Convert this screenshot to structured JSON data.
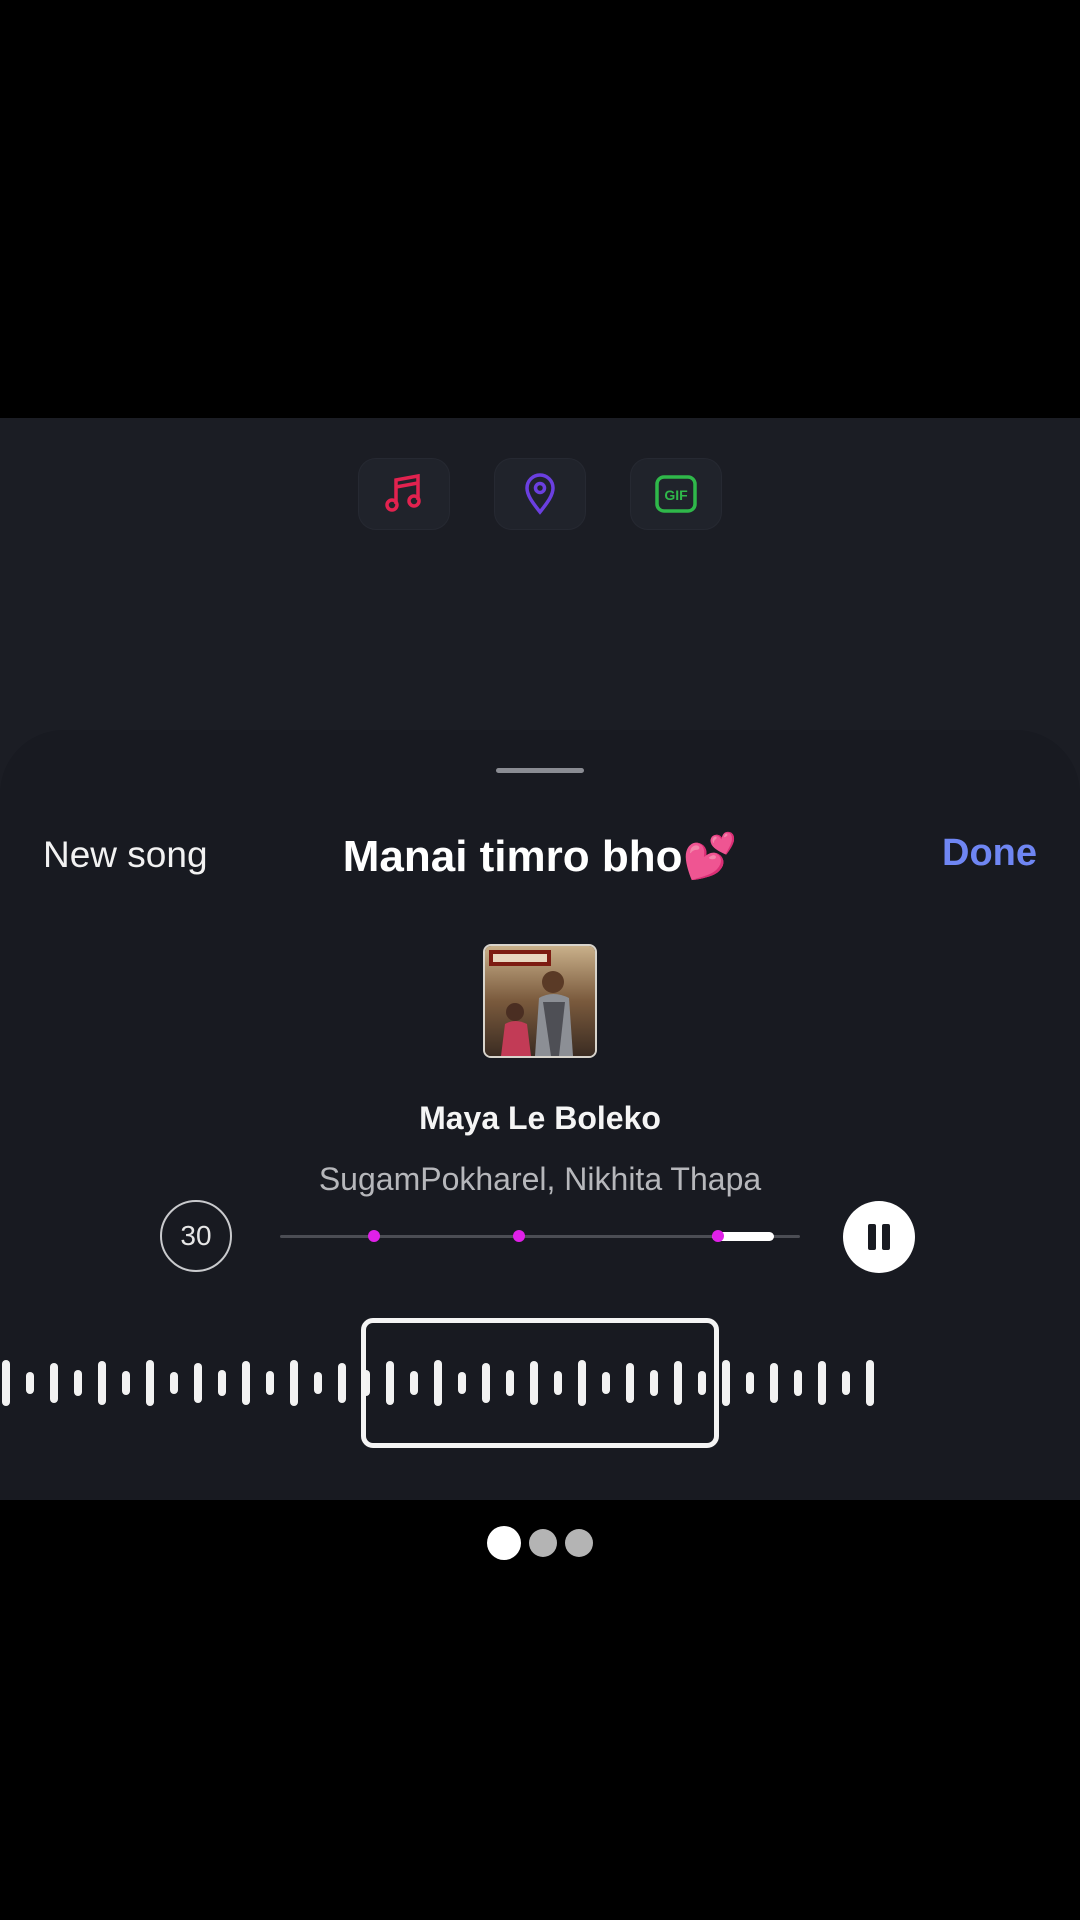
{
  "stickers": [
    {
      "icon": "music-note-icon",
      "color": "#e2224f"
    },
    {
      "icon": "location-pin-icon",
      "color": "#6b3fe0"
    },
    {
      "icon": "gif-icon",
      "label": "GIF",
      "color": "#2fb84a"
    }
  ],
  "header": {
    "new_song_label": "New song",
    "title": "Manai timro bho💕",
    "done_label": "Done"
  },
  "song": {
    "name": "Maya Le Boleko",
    "artist": "SugamPokharel, Nikhita Thapa",
    "duration": "30"
  },
  "player": {
    "state": "playing",
    "pause_icon": "pause-icon",
    "markers": [
      0.18,
      0.46
    ],
    "selection_start": 0.83,
    "selection_end": 0.95,
    "accent_color": "#e020e8"
  },
  "pager": {
    "count": 3,
    "active": 0
  },
  "colors": {
    "done": "#6f86f3",
    "sheet": "#181a21"
  }
}
